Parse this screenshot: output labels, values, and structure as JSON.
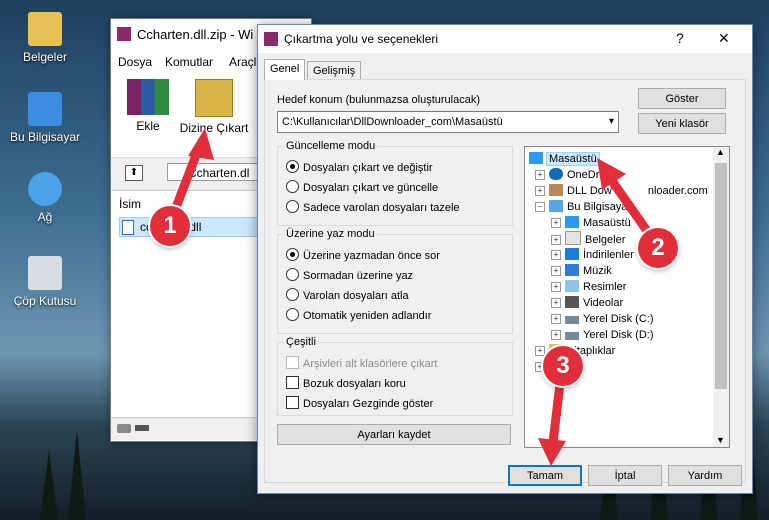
{
  "desktop": {
    "icons": [
      {
        "label": "Belgeler",
        "icon": "folder-icon"
      },
      {
        "label": "Bu Bilgisayar",
        "icon": "computer-icon"
      },
      {
        "label": "Ağ",
        "icon": "network-icon"
      },
      {
        "label": "Çöp Kutusu",
        "icon": "recycle-bin-icon"
      }
    ]
  },
  "winrar": {
    "title": "Ccharten.dll.zip - Wi",
    "menu": [
      "Dosya",
      "Komutlar",
      "Araçla"
    ],
    "toolbar": {
      "add": "Ekle",
      "extract": "Dizine Çıkart"
    },
    "path": "Ccharten.dl",
    "column": "İsim",
    "file": "ccharten.dll"
  },
  "dialog": {
    "title": "Çıkartma yolu ve seçenekleri",
    "help_glyph": "?",
    "close_glyph": "✕",
    "tabs": [
      "Genel",
      "Gelişmiş"
    ],
    "dest_label": "Hedef konum (bulunmazsa oluşturulacak)",
    "dest_value": "C:\\Kullanıcılar\\DllDownloader_com\\Masaüstü",
    "show_btn": "Göster",
    "new_folder_btn": "Yeni klasör",
    "update_mode": {
      "title": "Güncelleme modu",
      "options": [
        "Dosyaları çıkart ve değiştir",
        "Dosyaları çıkart ve güncelle",
        "Sadece varolan dosyaları tazele"
      ],
      "selected": 0
    },
    "overwrite_mode": {
      "title": "Üzerine yaz modu",
      "options": [
        "Üzerine yazmadan önce sor",
        "Sormadan üzerine yaz",
        "Varolan dosyaları atla",
        "Otomatik yeniden adlandır"
      ],
      "selected": 0
    },
    "misc": {
      "title": "Çeşitli",
      "options": [
        "Arşivleri alt klasörlere çıkart",
        "Bozuk dosyaları koru",
        "Dosyaları Gezginde göster"
      ]
    },
    "save_btn": "Ayarları kaydet",
    "tree": [
      {
        "label": "Masaüstü",
        "icon": "desktop-icon"
      },
      {
        "label": "OneDr",
        "icon": "onedrive-icon"
      },
      {
        "label": "DLL Dow",
        "icon": "user-icon"
      },
      {
        "label": "nloader.com"
      },
      {
        "label": "Bu Bilgisaya",
        "icon": "computer-icon"
      },
      {
        "label": "Masaüstü",
        "icon": "desktop-icon"
      },
      {
        "label": "Belgeler",
        "icon": "documents-icon"
      },
      {
        "label": "İndirilenler",
        "icon": "downloads-icon"
      },
      {
        "label": "Müzik",
        "icon": "music-icon"
      },
      {
        "label": "Resimler",
        "icon": "pictures-icon"
      },
      {
        "label": "Videolar",
        "icon": "videos-icon"
      },
      {
        "label": "Yerel Disk (C:)",
        "icon": "disk-icon"
      },
      {
        "label": "Yerel Disk (D:)",
        "icon": "disk-icon"
      },
      {
        "label": "Kitaplıklar",
        "icon": "libraries-icon"
      }
    ],
    "ok_btn": "Tamam",
    "cancel_btn": "İptal",
    "help_btn": "Yardım"
  },
  "annotations": [
    "1",
    "2",
    "3"
  ],
  "colors": {
    "accent": "#0078d7",
    "badge": "#e22e3a",
    "arrow": "#e22e3a"
  }
}
